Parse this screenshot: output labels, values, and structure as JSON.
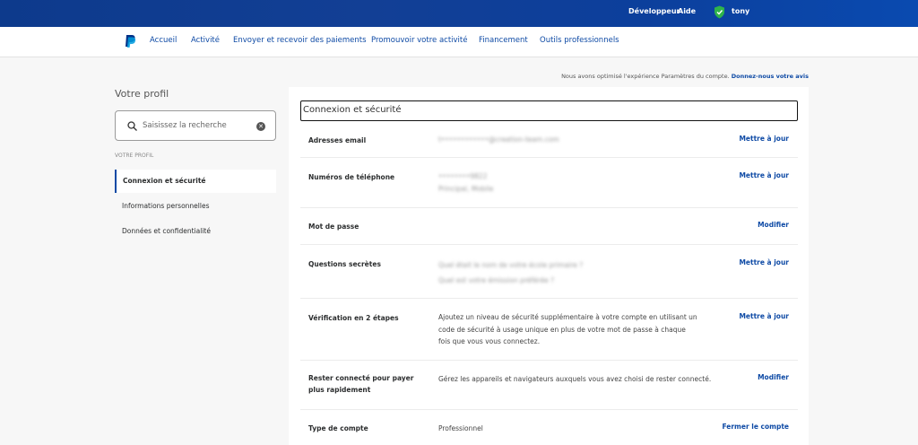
{
  "topbar": {
    "developer": "Développeur",
    "help": "Aide",
    "user": "tony"
  },
  "nav": {
    "items": [
      "Accueil",
      "Activité",
      "Envoyer et recevoir des paiements",
      "Promouvoir votre activité",
      "Financement",
      "Outils professionnels"
    ]
  },
  "notice": {
    "text": "Nous avons optimisé l'expérience Paramètres du compte.",
    "link": "Donnez-nous votre avis"
  },
  "sidebar": {
    "title": "Votre profil",
    "search_placeholder": "Saisissez la recherche",
    "section_label": "VOTRE PROFIL",
    "items": [
      "Connexion et sécurité",
      "Informations personnelles",
      "Données et confidentialité"
    ]
  },
  "panel": {
    "title": "Connexion et sécurité",
    "rows": [
      {
        "label": "Adresses email",
        "value": "t••••••••••••@creation-team.com",
        "action": "Mettre à jour"
      },
      {
        "label": "Numéros de téléphone",
        "value": "••••••••9822",
        "value2": "Principal, Mobile",
        "action": "Mettre à jour"
      },
      {
        "label": "Mot de passe",
        "value": "",
        "action": "Modifier"
      },
      {
        "label": "Questions secrètes",
        "value": "Quel était le nom de votre école primaire ?",
        "value2": "Quel est votre émission préférée ?",
        "action": "Mettre à jour"
      },
      {
        "label": "Vérification en 2 étapes",
        "value": "Ajoutez un niveau de sécurité supplémentaire à votre compte en utilisant un code de sécurité à usage unique en plus de votre mot de passe à chaque fois que vous vous connectez.",
        "action": "Mettre à jour"
      },
      {
        "label": "Rester connecté pour payer plus rapidement",
        "value": "Gérez les appareils et navigateurs auxquels vous avez choisi de rester connecté.",
        "action": "Modifier"
      },
      {
        "label": "Type de compte",
        "value": "Professionnel",
        "action": "Fermer le compte"
      }
    ]
  },
  "colors": {
    "brand_blue": "#0e4aa5",
    "topbar_blue": "#123f95"
  }
}
